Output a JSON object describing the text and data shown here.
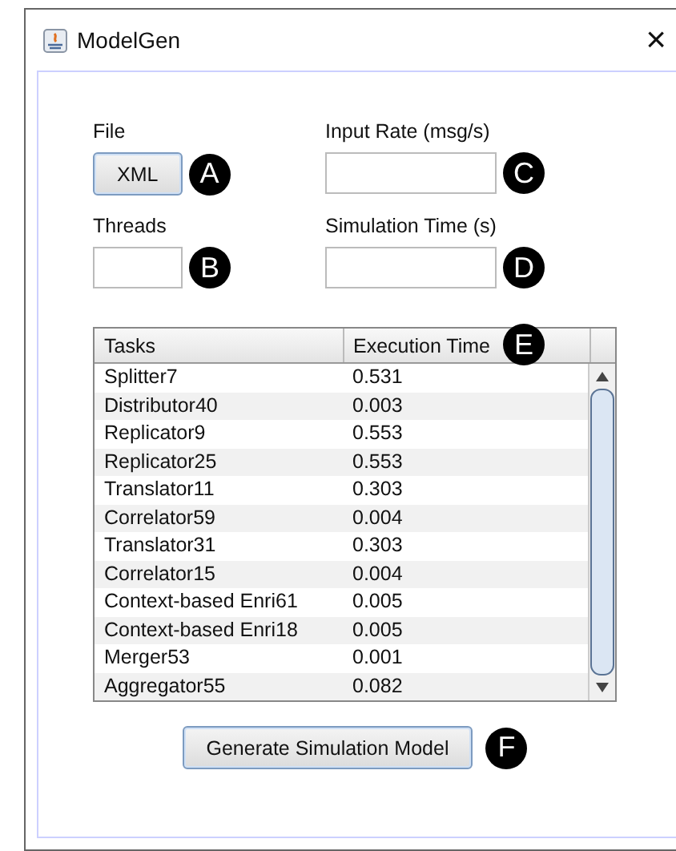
{
  "window": {
    "title": "ModelGen",
    "close": "×"
  },
  "fields": [
    {
      "kind": "button",
      "label": "File",
      "value": "XML",
      "marker": "A"
    },
    {
      "kind": "input",
      "label": "Input Rate (msg/s)",
      "marker": "C"
    },
    {
      "kind": "input",
      "label": "Threads",
      "marker": "B"
    },
    {
      "kind": "input",
      "label": "Simulation Time (s)",
      "marker": "D"
    }
  ],
  "table": {
    "columns": [
      "Tasks",
      "Execution Time"
    ],
    "marker": "E",
    "rows": [
      [
        "Splitter7",
        "0.531"
      ],
      [
        "Distributor40",
        "0.003"
      ],
      [
        "Replicator9",
        "0.553"
      ],
      [
        "Replicator25",
        "0.553"
      ],
      [
        "Translator11",
        "0.303"
      ],
      [
        "Correlator59",
        "0.004"
      ],
      [
        "Translator31",
        "0.303"
      ],
      [
        "Correlator15",
        "0.004"
      ],
      [
        "Context-based Enri61",
        "0.005"
      ],
      [
        "Context-based Enri18",
        "0.005"
      ],
      [
        "Merger53",
        "0.001"
      ],
      [
        "Aggregator55",
        "0.082"
      ]
    ]
  },
  "generate_button": {
    "label": "Generate Simulation Model",
    "marker": "F"
  }
}
